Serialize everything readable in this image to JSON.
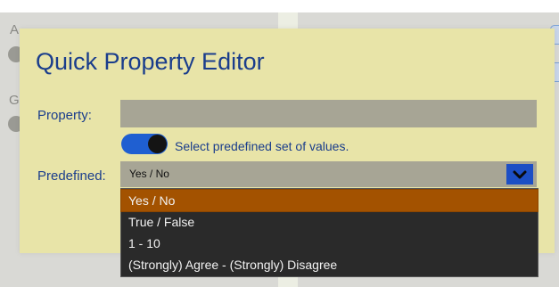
{
  "background": {
    "left_letters": [
      "A",
      "G"
    ]
  },
  "dialog": {
    "title": "Quick Property Editor",
    "property_label": "Property:",
    "property_value": "",
    "toggle_label": "Select predefined set of values.",
    "toggle_on": true,
    "predefined_label": "Predefined:",
    "predefined_value": "Yes / No"
  },
  "dropdown": {
    "options": [
      {
        "label": "Yes / No",
        "selected": true
      },
      {
        "label": "True / False",
        "selected": false
      },
      {
        "label": "1 - 10",
        "selected": false
      },
      {
        "label": "(Strongly) Agree - (Strongly) Disagree",
        "selected": false
      }
    ]
  },
  "colors": {
    "dialog_bg": "#e8e4a8",
    "title_color": "#1a3d8c",
    "accent_blue": "#1d4fc4",
    "selected_option": "#a35200",
    "dropdown_bg": "#2a2a2a"
  },
  "icons": {
    "select_chevron": "chevron-down-icon"
  }
}
